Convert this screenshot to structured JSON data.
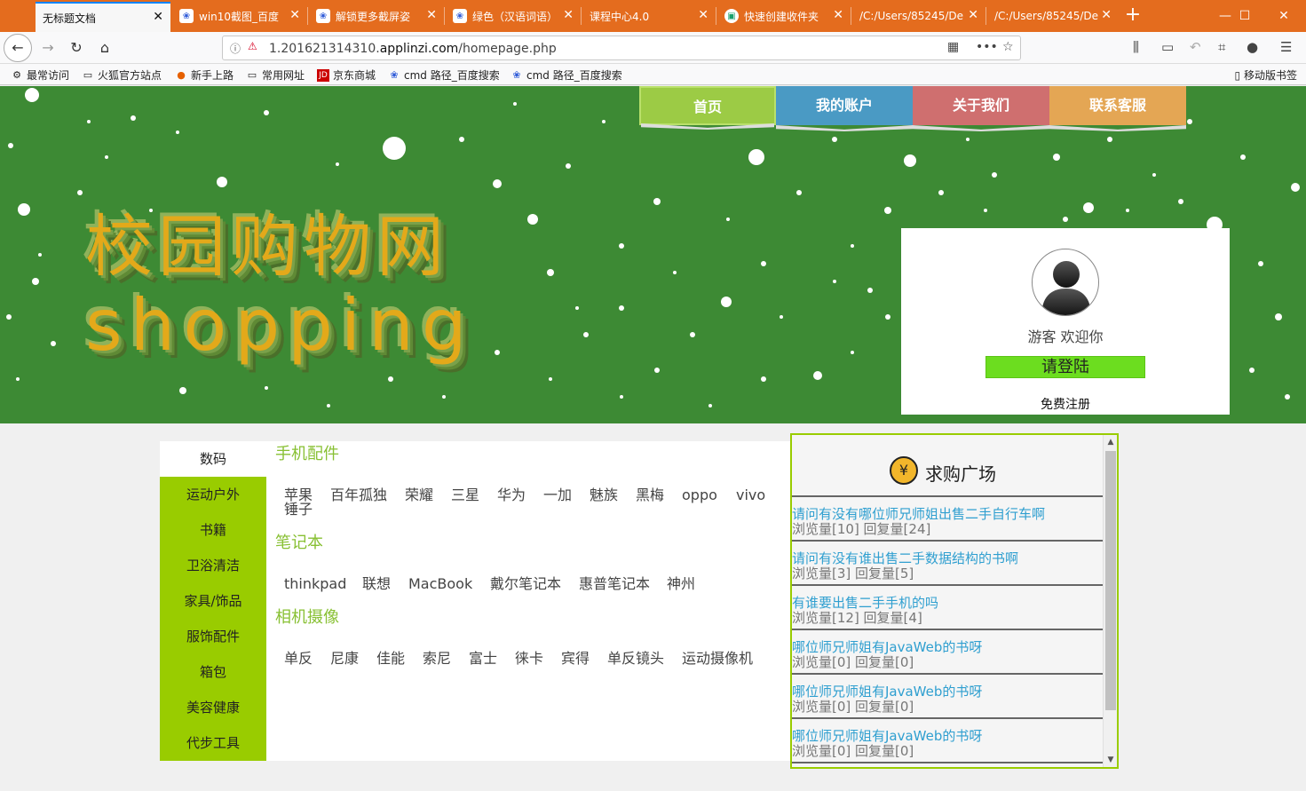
{
  "browser": {
    "tabs": [
      {
        "title": "无标题文档",
        "active": true,
        "icon": "none"
      },
      {
        "title": "win10截图_百度",
        "icon": "baidu-paw-icon"
      },
      {
        "title": "解锁更多截屏姿",
        "icon": "baidu-paw-icon"
      },
      {
        "title": "绿色（汉语词语）",
        "icon": "baidu-paw-icon"
      },
      {
        "title": "课程中心4.0",
        "icon": "none"
      },
      {
        "title": "快速创建收件夹",
        "icon": "green-app-icon"
      },
      {
        "title": "/C:/Users/85245/De",
        "icon": "none"
      },
      {
        "title": "/C:/Users/85245/De",
        "icon": "none"
      }
    ],
    "url_host": "1.201621314310.",
    "url_domain": "applinzi.com",
    "url_path": "/homepage.php",
    "bookmarks": [
      {
        "label": "最常访问",
        "icon": "gear-icon"
      },
      {
        "label": "火狐官方站点",
        "icon": "folder-icon"
      },
      {
        "label": "新手上路",
        "icon": "firefox-icon"
      },
      {
        "label": "常用网址",
        "icon": "folder-icon"
      },
      {
        "label": "京东商城",
        "icon": "jd-icon"
      },
      {
        "label": "cmd 路径_百度搜索",
        "icon": "baidu-paw-icon"
      },
      {
        "label": "cmd 路径_百度搜索",
        "icon": "baidu-paw-icon"
      }
    ],
    "mobile_bookmarks": "移动版书签"
  },
  "header": {
    "nav": [
      {
        "label": "首页",
        "color": "#9ccb45"
      },
      {
        "label": "我的账户",
        "color": "#4a9ac4"
      },
      {
        "label": "关于我们",
        "color": "#cf6f6f"
      },
      {
        "label": "联系客服",
        "color": "#e4a654"
      }
    ],
    "logo_cn": "校园购物网",
    "logo_en": "shopping"
  },
  "login": {
    "welcome": "游客 欢迎你",
    "login_label": "请登陆",
    "register_label": "免费注册"
  },
  "categories": [
    "数码",
    "运动户外",
    "书籍",
    "卫浴清洁",
    "家具/饰品",
    "服饰配件",
    "箱包",
    "美容健康",
    "代步工具"
  ],
  "sections": [
    {
      "title": "手机配件",
      "tags": [
        "苹果",
        "百年孤独",
        "荣耀",
        "三星",
        "华为",
        "一加",
        "魅族",
        "黑梅",
        "oppo",
        "vivo",
        "锤子"
      ]
    },
    {
      "title": "笔记本",
      "tags": [
        "thinkpad",
        "联想",
        "MacBook",
        "戴尔笔记本",
        "惠普笔记本",
        "神州"
      ]
    },
    {
      "title": "相机摄像",
      "tags": [
        "单反",
        "尼康",
        "佳能",
        "索尼",
        "富士",
        "徕卡",
        "宾得",
        "单反镜头",
        "运动摄像机"
      ]
    }
  ],
  "board": {
    "title": "求购广场",
    "posts": [
      {
        "q": "请问有没有哪位师兄师姐出售二手自行车啊",
        "meta": "浏览量[10] 回复量[24]"
      },
      {
        "q": "请问有没有谁出售二手数据结构的书啊",
        "meta": "浏览量[3] 回复量[5]"
      },
      {
        "q": "有谁要出售二手手机的吗",
        "meta": "浏览量[12] 回复量[4]"
      },
      {
        "q": "哪位师兄师姐有JavaWeb的书呀",
        "meta": "浏览量[0] 回复量[0]"
      },
      {
        "q": "哪位师兄师姐有JavaWeb的书呀",
        "meta": "浏览量[0] 回复量[0]"
      },
      {
        "q": "哪位师兄师姐有JavaWeb的书呀",
        "meta": "浏览量[0] 回复量[0]"
      }
    ]
  }
}
